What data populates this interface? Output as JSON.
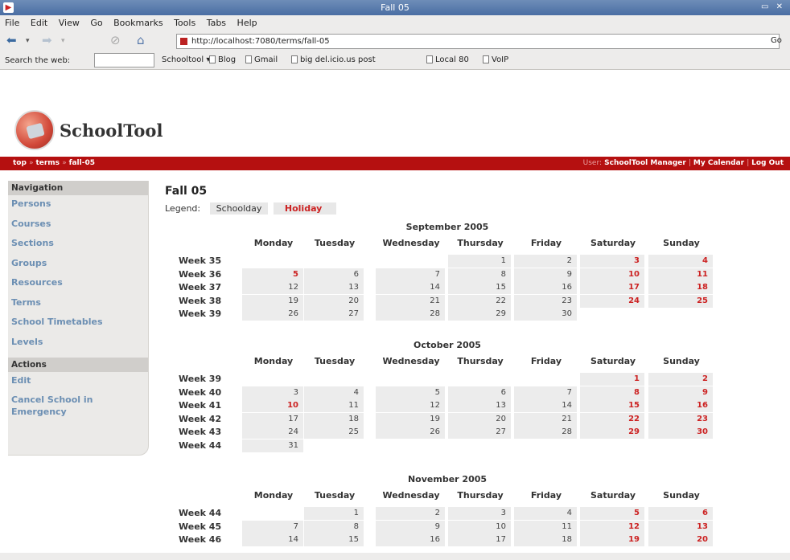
{
  "window": {
    "title": "Fall 05"
  },
  "menu": [
    "File",
    "Edit",
    "View",
    "Go",
    "Bookmarks",
    "Tools",
    "Tabs",
    "Help"
  ],
  "nav": {
    "url": "http://localhost:7080/terms/fall-05",
    "go": "Go"
  },
  "toolbar": {
    "search_label": "Search the web:",
    "search_value": "",
    "schooltool_menu": "Schooltool ▾",
    "bookmarks": [
      "Blog",
      "Gmail",
      "big del.icio.us post",
      "Local 80",
      "VoIP"
    ]
  },
  "site": {
    "logo_text": "SchoolTool",
    "breadcrumb": [
      "top",
      "terms",
      "fall-05"
    ],
    "user_label": "User:",
    "user_name": "SchoolTool Manager",
    "my_calendar": "My Calendar",
    "logout": "Log Out"
  },
  "sidebar": {
    "nav_title": "Navigation",
    "nav_items": [
      "Persons",
      "Courses",
      "Sections",
      "Groups",
      "Resources",
      "Terms",
      "School Timetables",
      "Levels"
    ],
    "actions_title": "Actions",
    "action_items": [
      "Edit",
      "Cancel School in Emergency"
    ]
  },
  "main": {
    "title": "Fall 05",
    "legend_label": "Legend:",
    "legend_schoolday": "Schoolday",
    "legend_holiday": "Holiday",
    "day_names": [
      "Monday",
      "Tuesday",
      "Wednesday",
      "Thursday",
      "Friday",
      "Saturday",
      "Sunday"
    ],
    "months": [
      {
        "title": "September 2005",
        "weeks": [
          {
            "label": "Week 35",
            "days": [
              "",
              "",
              "",
              "1",
              "2",
              "3",
              "4"
            ]
          },
          {
            "label": "Week 36",
            "days": [
              "5",
              "6",
              "7",
              "8",
              "9",
              "10",
              "11"
            ]
          },
          {
            "label": "Week 37",
            "days": [
              "12",
              "13",
              "14",
              "15",
              "16",
              "17",
              "18"
            ]
          },
          {
            "label": "Week 38",
            "days": [
              "19",
              "20",
              "21",
              "22",
              "23",
              "24",
              "25"
            ]
          },
          {
            "label": "Week 39",
            "days": [
              "26",
              "27",
              "28",
              "29",
              "30",
              "",
              ""
            ]
          }
        ],
        "holidays": [
          "3",
          "4",
          "5",
          "10",
          "11",
          "17",
          "18",
          "24",
          "25"
        ]
      },
      {
        "title": "October 2005",
        "weeks": [
          {
            "label": "Week 39",
            "days": [
              "",
              "",
              "",
              "",
              "",
              "1",
              "2"
            ]
          },
          {
            "label": "Week 40",
            "days": [
              "3",
              "4",
              "5",
              "6",
              "7",
              "8",
              "9"
            ]
          },
          {
            "label": "Week 41",
            "days": [
              "10",
              "11",
              "12",
              "13",
              "14",
              "15",
              "16"
            ]
          },
          {
            "label": "Week 42",
            "days": [
              "17",
              "18",
              "19",
              "20",
              "21",
              "22",
              "23"
            ]
          },
          {
            "label": "Week 43",
            "days": [
              "24",
              "25",
              "26",
              "27",
              "28",
              "29",
              "30"
            ]
          },
          {
            "label": "Week 44",
            "days": [
              "31",
              "",
              "",
              "",
              "",
              "",
              ""
            ]
          }
        ],
        "holidays": [
          "1",
          "2",
          "8",
          "9",
          "10",
          "15",
          "16",
          "22",
          "23",
          "29",
          "30"
        ]
      },
      {
        "title": "November 2005",
        "weeks": [
          {
            "label": "Week 44",
            "days": [
              "",
              "1",
              "2",
              "3",
              "4",
              "5",
              "6"
            ]
          },
          {
            "label": "Week 45",
            "days": [
              "7",
              "8",
              "9",
              "10",
              "11",
              "12",
              "13"
            ]
          },
          {
            "label": "Week 46",
            "days": [
              "14",
              "15",
              "16",
              "17",
              "18",
              "19",
              "20"
            ]
          }
        ],
        "holidays": [
          "5",
          "6",
          "12",
          "13",
          "19",
          "20"
        ]
      }
    ]
  },
  "colors": {
    "accent_red": "#b51010",
    "holiday": "#cc2222",
    "link": "#6c8fb3"
  }
}
